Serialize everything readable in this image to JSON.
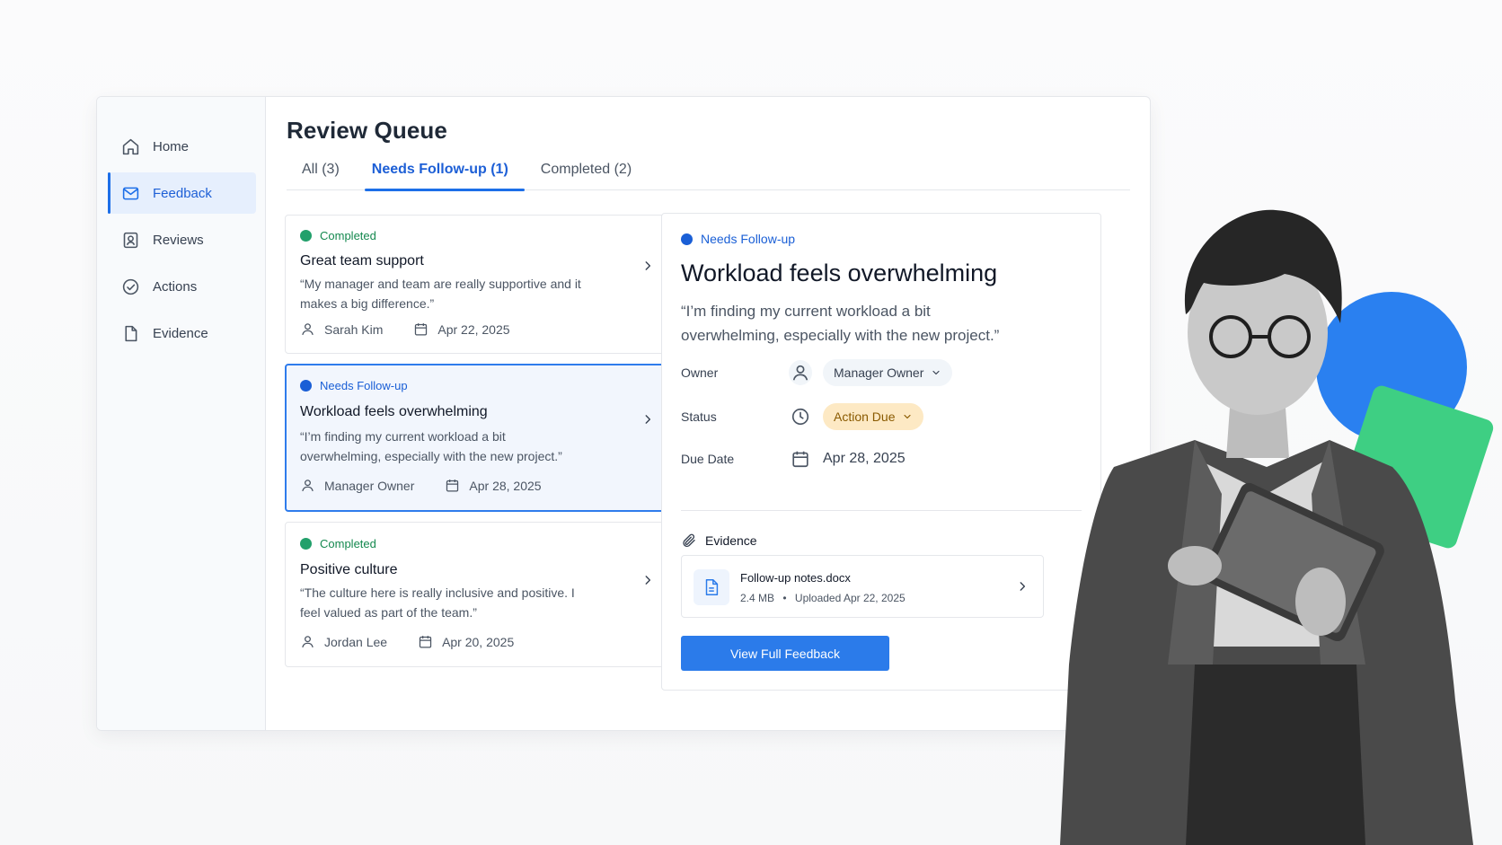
{
  "sidebar": {
    "items": [
      {
        "label": "Home",
        "icon": "home-icon"
      },
      {
        "label": "Feedback",
        "icon": "mail-icon",
        "active": true
      },
      {
        "label": "Reviews",
        "icon": "reviews-icon"
      },
      {
        "label": "Actions",
        "icon": "check-circle-icon"
      },
      {
        "label": "Evidence",
        "icon": "document-icon"
      }
    ]
  },
  "main": {
    "title": "Review Queue",
    "tabs": [
      {
        "label": "All (3)"
      },
      {
        "label": "Needs Follow-up (1)",
        "active": true
      },
      {
        "label": "Completed (2)"
      }
    ]
  },
  "cards": [
    {
      "status": "Completed",
      "title": "Great team support",
      "quote": "“My manager and team are really supportive and it makes a big difference.”",
      "person": "Sarah Kim",
      "date": "Apr 22, 2025"
    },
    {
      "status": "Needs Follow-up",
      "title": "Workload feels overwhelming",
      "quote": "“I’m finding my current workload a bit overwhelming, especially with the new project.”",
      "person": "Manager Owner",
      "date": "Apr 28, 2025"
    },
    {
      "status": "Completed",
      "title": "Positive culture",
      "quote": "“The culture here is really inclusive and positive. I feel valued as part of the team.”",
      "person": "Jordan Lee",
      "date": "Apr 20, 2025"
    }
  ],
  "detail": {
    "status": "Needs Follow-up",
    "title": "Workload feels overwhelming",
    "quote": "“I’m finding my current workload a bit overwhelming, especially with the new project.”",
    "owner_label": "Owner",
    "owner_value": "Manager Owner",
    "status_label": "Status",
    "status_value": "Action Due",
    "due_label": "Due Date",
    "due_value": "Apr 28, 2025",
    "evidence_label": "Evidence",
    "file_name": "Follow-up notes.docx",
    "file_size": "2.4 MB",
    "file_uploaded": "Uploaded Apr 22, 2025",
    "button_label": "View Full Feedback"
  },
  "colors": {
    "accent": "#2b7bea",
    "completed": "#22a06b",
    "followup": "#1a5fd6",
    "action_due_bg": "#fde9c4"
  }
}
